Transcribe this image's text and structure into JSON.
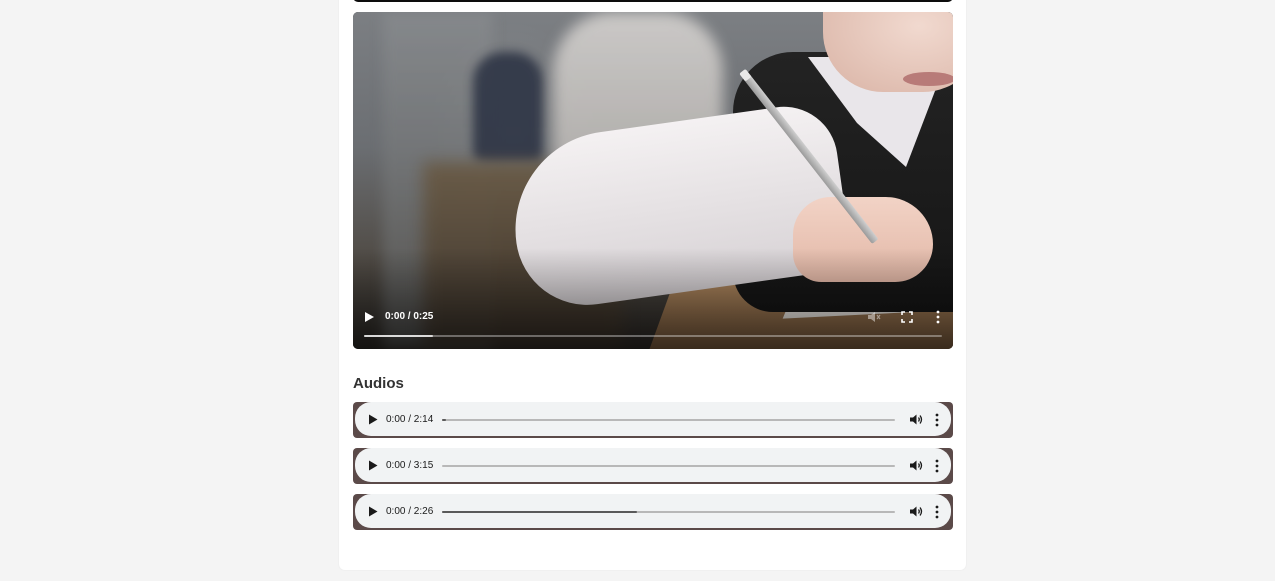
{
  "video": {
    "time_display": "0:00 / 0:25",
    "buffered_fraction": 0.12
  },
  "audios_section": {
    "title": "Audios",
    "players": [
      {
        "time_display": "0:00 / 2:14",
        "progress_fraction": 0.005
      },
      {
        "time_display": "0:00 / 3:15",
        "progress_fraction": 0.0
      },
      {
        "time_display": "0:00 / 2:26",
        "progress_fraction": 0.43
      }
    ]
  },
  "colors": {
    "page_background": "#f4f4f4",
    "card_background": "#ffffff",
    "audio_frame": "#5b4a49",
    "audio_panel": "#f1f3f4",
    "heading_text": "#333333"
  },
  "icons": {
    "play": "play-icon",
    "volume": "volume-icon",
    "muted": "mute-icon",
    "fullscreen": "fullscreen-icon",
    "more": "more-options-icon"
  }
}
